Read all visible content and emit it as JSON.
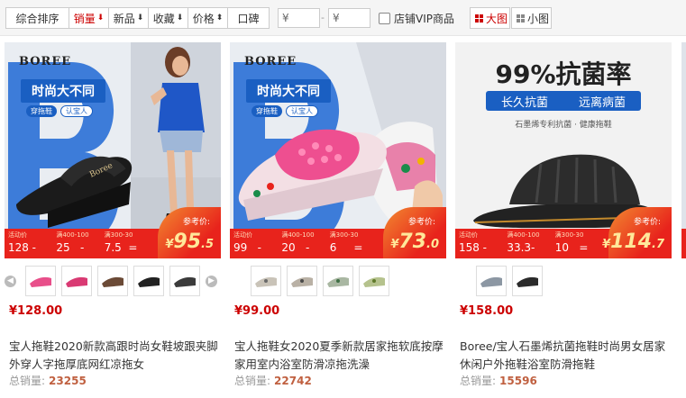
{
  "toolbar": {
    "sort": [
      {
        "label": "综合排序",
        "arrow": "",
        "active": false
      },
      {
        "label": "销量",
        "arrow": "⬇",
        "active": true
      },
      {
        "label": "新品",
        "arrow": "⬇",
        "active": false
      },
      {
        "label": "收藏",
        "arrow": "⬇",
        "active": false
      },
      {
        "label": "价格",
        "arrow": "⬍",
        "active": false
      },
      {
        "label": "口碑",
        "arrow": "",
        "active": false
      }
    ],
    "price_currency": "¥",
    "price_dash": "-",
    "vip_label": "店铺VIP商品",
    "view_large": "大图",
    "view_small": "小图"
  },
  "products": [
    {
      "brand": "BOREE",
      "tagline": "时尚大不同",
      "pill_a": "穿拖鞋",
      "pill_b": "认宝人",
      "promo_labels": [
        "活动价",
        "满400-100",
        "满300-30"
      ],
      "promo_values": [
        "128",
        "-",
        "25",
        "-",
        "7.5",
        "="
      ],
      "ref_label": "参考价:",
      "ref_currency": "¥",
      "ref_int": "95",
      "ref_dec": ".5",
      "price": "¥128.00",
      "title": "宝人拖鞋2020新款高跟时尚女鞋坡跟夹脚外穿人字拖厚底网红凉拖女",
      "sales_label": "总销量:",
      "sales": "23255"
    },
    {
      "brand": "BOREE",
      "tagline": "时尚大不同",
      "pill_a": "穿拖鞋",
      "pill_b": "认宝人",
      "promo_labels": [
        "活动价",
        "满400-100",
        "满300-30"
      ],
      "promo_values": [
        "99",
        "-",
        "20",
        "-",
        "6",
        "="
      ],
      "ref_label": "参考价:",
      "ref_currency": "¥",
      "ref_int": "73",
      "ref_dec": ".0",
      "price": "¥99.00",
      "title": "宝人拖鞋女2020夏季新款居家拖软底按摩家用室内浴室防滑凉拖洗澡",
      "sales_label": "总销量:",
      "sales": "22742"
    },
    {
      "headline": "99%抗菌率",
      "band_a": "长久抗菌",
      "band_b": "远离病菌",
      "subline": "石墨烯专利抗菌 · 健康拖鞋",
      "promo_labels": [
        "活动价",
        "满400-100",
        "满300-30"
      ],
      "promo_values": [
        "158",
        "-",
        "33.3",
        "-",
        "10",
        "="
      ],
      "ref_label": "参考价:",
      "ref_currency": "¥",
      "ref_int": "114",
      "ref_dec": ".7",
      "price": "¥158.00",
      "title": "Boree/宝人石墨烯抗菌拖鞋时尚男女居家休闲户外拖鞋浴室防滑拖鞋",
      "sales_label": "总销量:",
      "sales": "15596"
    }
  ],
  "colors": {
    "accent": "#cc0000",
    "promo_red": "#e8231c",
    "brand_blue": "#1a5fc2"
  }
}
